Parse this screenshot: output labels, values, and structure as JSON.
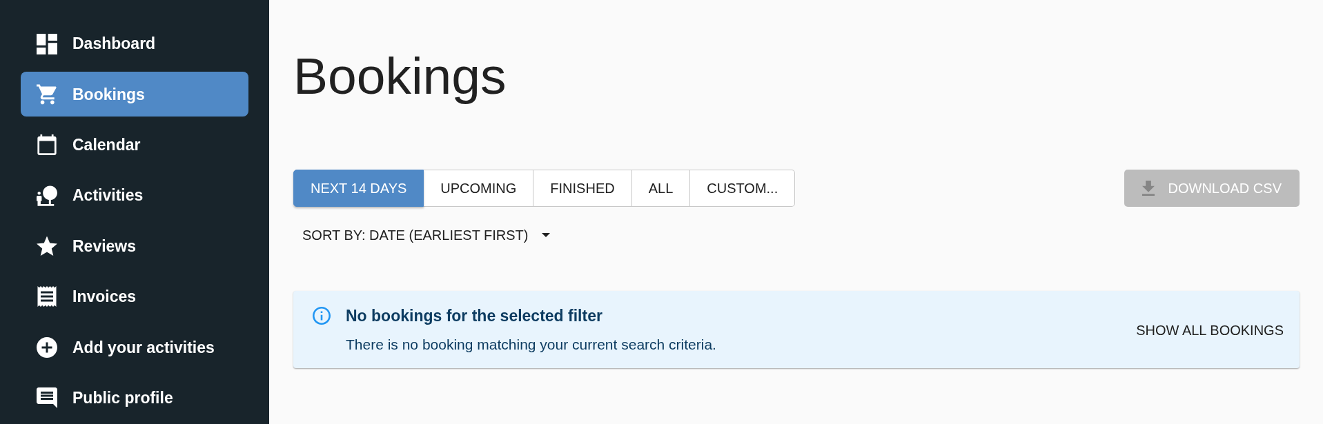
{
  "sidebar": {
    "items": [
      {
        "label": "Dashboard",
        "selected": false
      },
      {
        "label": "Bookings",
        "selected": true
      },
      {
        "label": "Calendar",
        "selected": false
      },
      {
        "label": "Activities",
        "selected": false
      },
      {
        "label": "Reviews",
        "selected": false
      },
      {
        "label": "Invoices",
        "selected": false
      },
      {
        "label": "Add your activities",
        "selected": false
      },
      {
        "label": "Public profile",
        "selected": false
      }
    ]
  },
  "page_title": "Bookings",
  "filter_tabs": [
    {
      "label": "NEXT 14 DAYS",
      "selected": true
    },
    {
      "label": "UPCOMING",
      "selected": false
    },
    {
      "label": "FINISHED",
      "selected": false
    },
    {
      "label": "ALL",
      "selected": false
    },
    {
      "label": "CUSTOM...",
      "selected": false
    }
  ],
  "download_button": {
    "label": "DOWNLOAD CSV",
    "disabled": true
  },
  "sort": {
    "label": "SORT BY: DATE (EARLIEST FIRST)"
  },
  "alert": {
    "title": "No bookings for the selected filter",
    "message": "There is no booking matching your current search criteria.",
    "action": "SHOW ALL BOOKINGS"
  }
}
